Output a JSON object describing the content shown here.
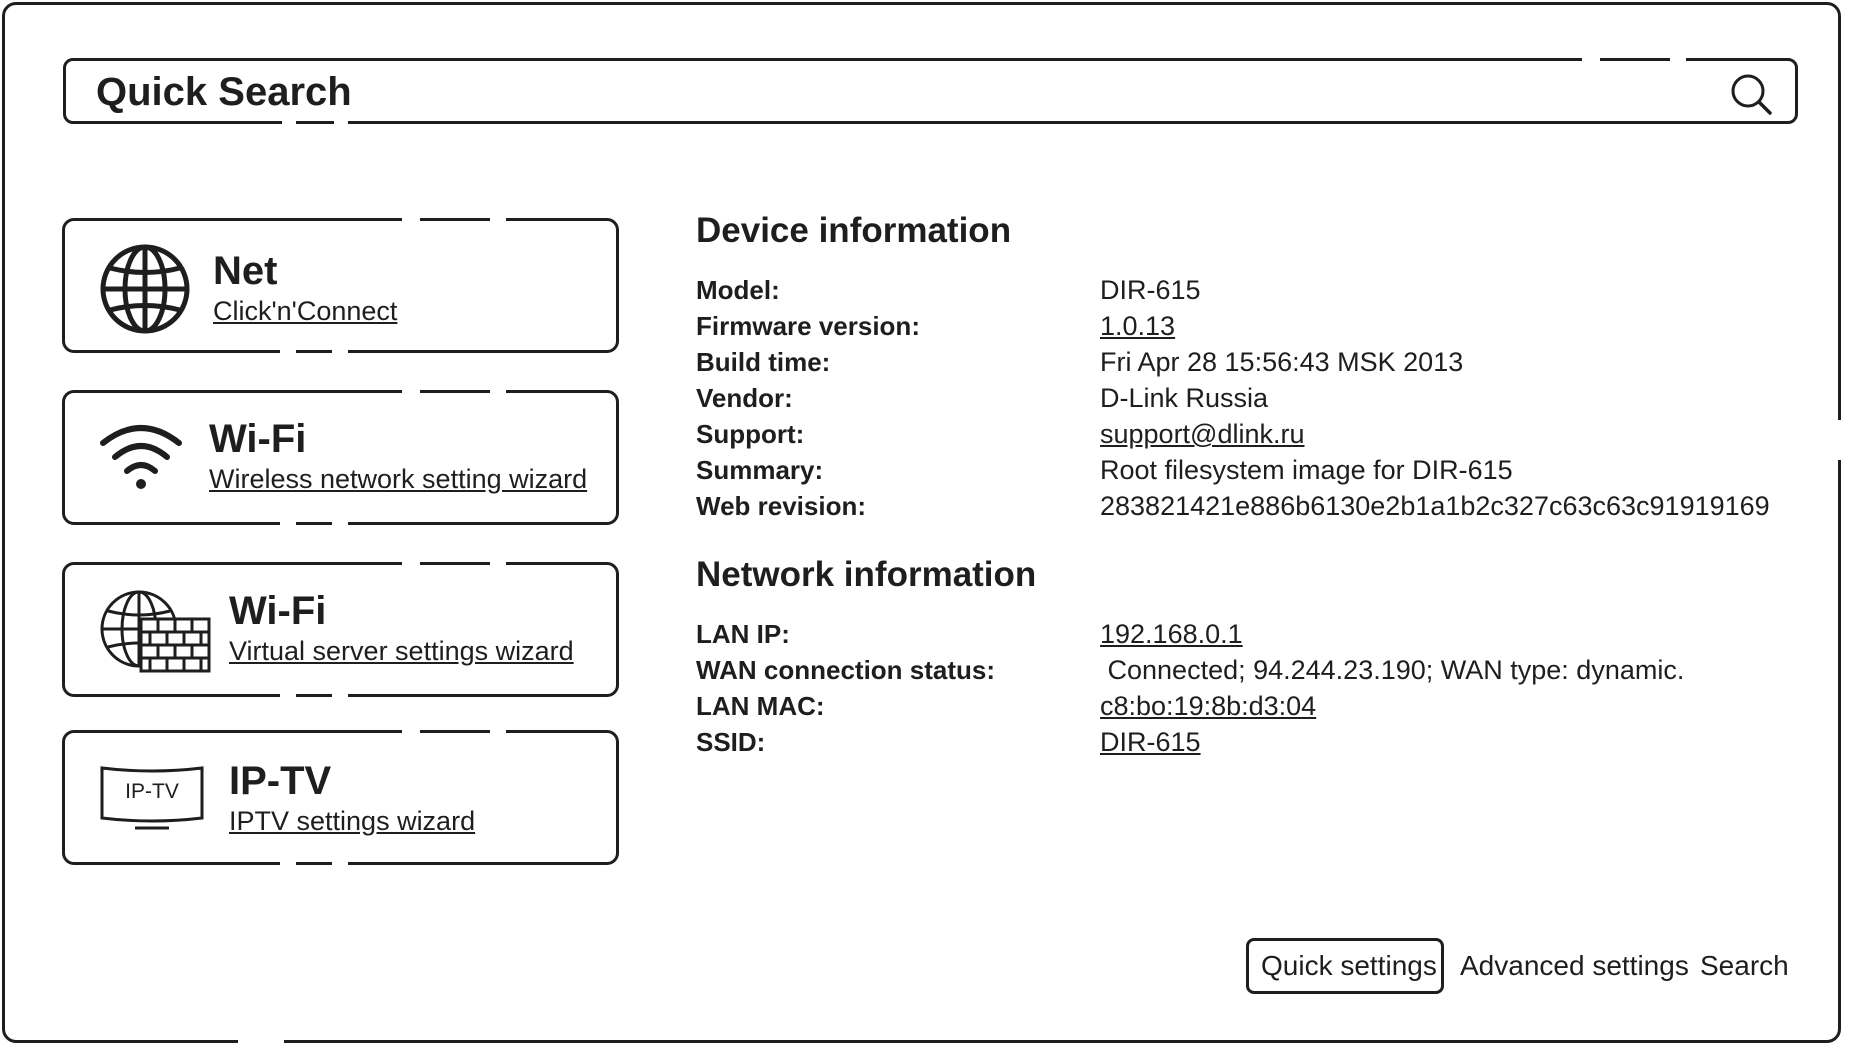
{
  "search": {
    "title": "Quick Search",
    "icon": "search-icon"
  },
  "cards": [
    {
      "icon": "globe-icon",
      "title": "Net",
      "link": "Click'n'Connect"
    },
    {
      "icon": "wifi-icon",
      "title": "Wi-Fi",
      "link": "Wireless network setting wizard"
    },
    {
      "icon": "globe-firewall-icon",
      "title": "Wi-Fi",
      "link": "Virtual server settings wizard"
    },
    {
      "icon": "tv-icon",
      "icon_text": "IP-TV",
      "title": "IP-TV",
      "link": "IPTV settings wizard"
    }
  ],
  "device_info": {
    "title": "Device information",
    "rows": [
      {
        "label": "Model:",
        "value": "DIR-615"
      },
      {
        "label": "Firmware version:",
        "value": "1.0.13"
      },
      {
        "label": "Build time:",
        "value": "Fri Apr 28 15:56:43 MSK 2013"
      },
      {
        "label": "Vendor:",
        "value": "D-Link Russia"
      },
      {
        "label": "Support:",
        "value": "support@dlink.ru"
      },
      {
        "label": "Summary:",
        "value": "Root filesystem image for DIR-615"
      },
      {
        "label": "Web revision:",
        "value": "283821421e886b6130e2b1a1b2c327c63c63c91919169"
      }
    ]
  },
  "network_info": {
    "title": "Network information",
    "rows": [
      {
        "label": "LAN IP:",
        "value": "192.168.0.1"
      },
      {
        "label": "WAN connection status:",
        "value": " Connected; 94.244.23.190; WAN type: dynamic."
      },
      {
        "label": "LAN MAC:",
        "value": "c8:bo:19:8b:d3:04"
      },
      {
        "label": "SSID:",
        "value": "DIR-615"
      }
    ]
  },
  "nav": {
    "quick_settings": "Quick settings",
    "advanced_settings": "Advanced settings",
    "search": "Search"
  },
  "colors": {
    "ink": "#1e1e1e",
    "background": "#ffffff"
  }
}
